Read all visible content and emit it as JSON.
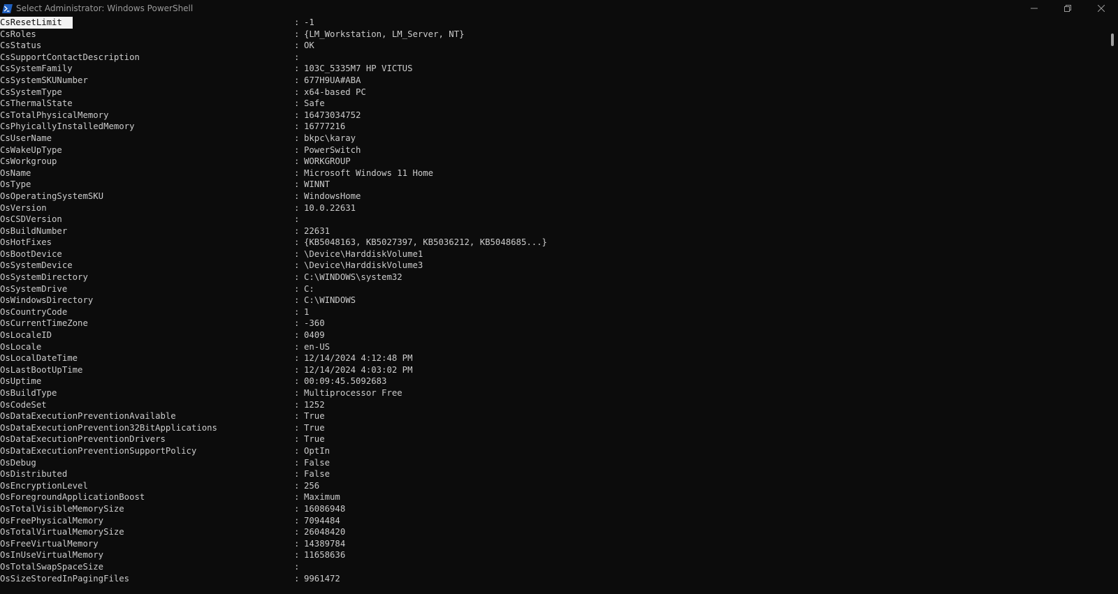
{
  "window": {
    "title": "Select Administrator: Windows PowerShell",
    "icon": "powershell-icon",
    "controls": {
      "minimize": "—",
      "maximize": "❐",
      "close": "✕"
    }
  },
  "theme": {
    "background": "#0c0c0c",
    "foreground": "#cccccc",
    "selection_bg": "#f2f2f2",
    "icon_blue": "#1f5fbf"
  },
  "console": {
    "separator": ":",
    "rows": [
      {
        "key": "CsResetLimit",
        "value": "-1"
      },
      {
        "key": "CsRoles",
        "value": "{LM_Workstation, LM_Server, NT}"
      },
      {
        "key": "CsStatus",
        "value": "OK"
      },
      {
        "key": "CsSupportContactDescription",
        "value": ""
      },
      {
        "key": "CsSystemFamily",
        "value": "103C_5335M7 HP VICTUS"
      },
      {
        "key": "CsSystemSKUNumber",
        "value": "677H9UA#ABA"
      },
      {
        "key": "CsSystemType",
        "value": "x64-based PC"
      },
      {
        "key": "CsThermalState",
        "value": "Safe"
      },
      {
        "key": "CsTotalPhysicalMemory",
        "value": "16473034752"
      },
      {
        "key": "CsPhyicallyInstalledMemory",
        "value": "16777216"
      },
      {
        "key": "CsUserName",
        "value": "bkpc\\karay"
      },
      {
        "key": "CsWakeUpType",
        "value": "PowerSwitch"
      },
      {
        "key": "CsWorkgroup",
        "value": "WORKGROUP"
      },
      {
        "key": "OsName",
        "value": "Microsoft Windows 11 Home"
      },
      {
        "key": "OsType",
        "value": "WINNT"
      },
      {
        "key": "OsOperatingSystemSKU",
        "value": "WindowsHome"
      },
      {
        "key": "OsVersion",
        "value": "10.0.22631"
      },
      {
        "key": "OsCSDVersion",
        "value": ""
      },
      {
        "key": "OsBuildNumber",
        "value": "22631"
      },
      {
        "key": "OsHotFixes",
        "value": "{KB5048163, KB5027397, KB5036212, KB5048685...}"
      },
      {
        "key": "OsBootDevice",
        "value": "\\Device\\HarddiskVolume1"
      },
      {
        "key": "OsSystemDevice",
        "value": "\\Device\\HarddiskVolume3"
      },
      {
        "key": "OsSystemDirectory",
        "value": "C:\\WINDOWS\\system32"
      },
      {
        "key": "OsSystemDrive",
        "value": "C:"
      },
      {
        "key": "OsWindowsDirectory",
        "value": "C:\\WINDOWS"
      },
      {
        "key": "OsCountryCode",
        "value": "1"
      },
      {
        "key": "OsCurrentTimeZone",
        "value": "-360"
      },
      {
        "key": "OsLocaleID",
        "value": "0409"
      },
      {
        "key": "OsLocale",
        "value": "en-US"
      },
      {
        "key": "OsLocalDateTime",
        "value": "12/14/2024 4:12:48 PM"
      },
      {
        "key": "OsLastBootUpTime",
        "value": "12/14/2024 4:03:02 PM"
      },
      {
        "key": "OsUptime",
        "value": "00:09:45.5092683"
      },
      {
        "key": "OsBuildType",
        "value": "Multiprocessor Free"
      },
      {
        "key": "OsCodeSet",
        "value": "1252"
      },
      {
        "key": "OsDataExecutionPreventionAvailable",
        "value": "True"
      },
      {
        "key": "OsDataExecutionPrevention32BitApplications",
        "value": "True"
      },
      {
        "key": "OsDataExecutionPreventionDrivers",
        "value": "True"
      },
      {
        "key": "OsDataExecutionPreventionSupportPolicy",
        "value": "OptIn"
      },
      {
        "key": "OsDebug",
        "value": "False"
      },
      {
        "key": "OsDistributed",
        "value": "False"
      },
      {
        "key": "OsEncryptionLevel",
        "value": "256"
      },
      {
        "key": "OsForegroundApplicationBoost",
        "value": "Maximum"
      },
      {
        "key": "OsTotalVisibleMemorySize",
        "value": "16086948"
      },
      {
        "key": "OsFreePhysicalMemory",
        "value": "7094484"
      },
      {
        "key": "OsTotalVirtualMemorySize",
        "value": "26048420"
      },
      {
        "key": "OsFreeVirtualMemory",
        "value": "14389784"
      },
      {
        "key": "OsInUseVirtualMemory",
        "value": "11658636"
      },
      {
        "key": "OsTotalSwapSpaceSize",
        "value": ""
      },
      {
        "key": "OsSizeStoredInPagingFiles",
        "value": "9961472"
      }
    ]
  }
}
